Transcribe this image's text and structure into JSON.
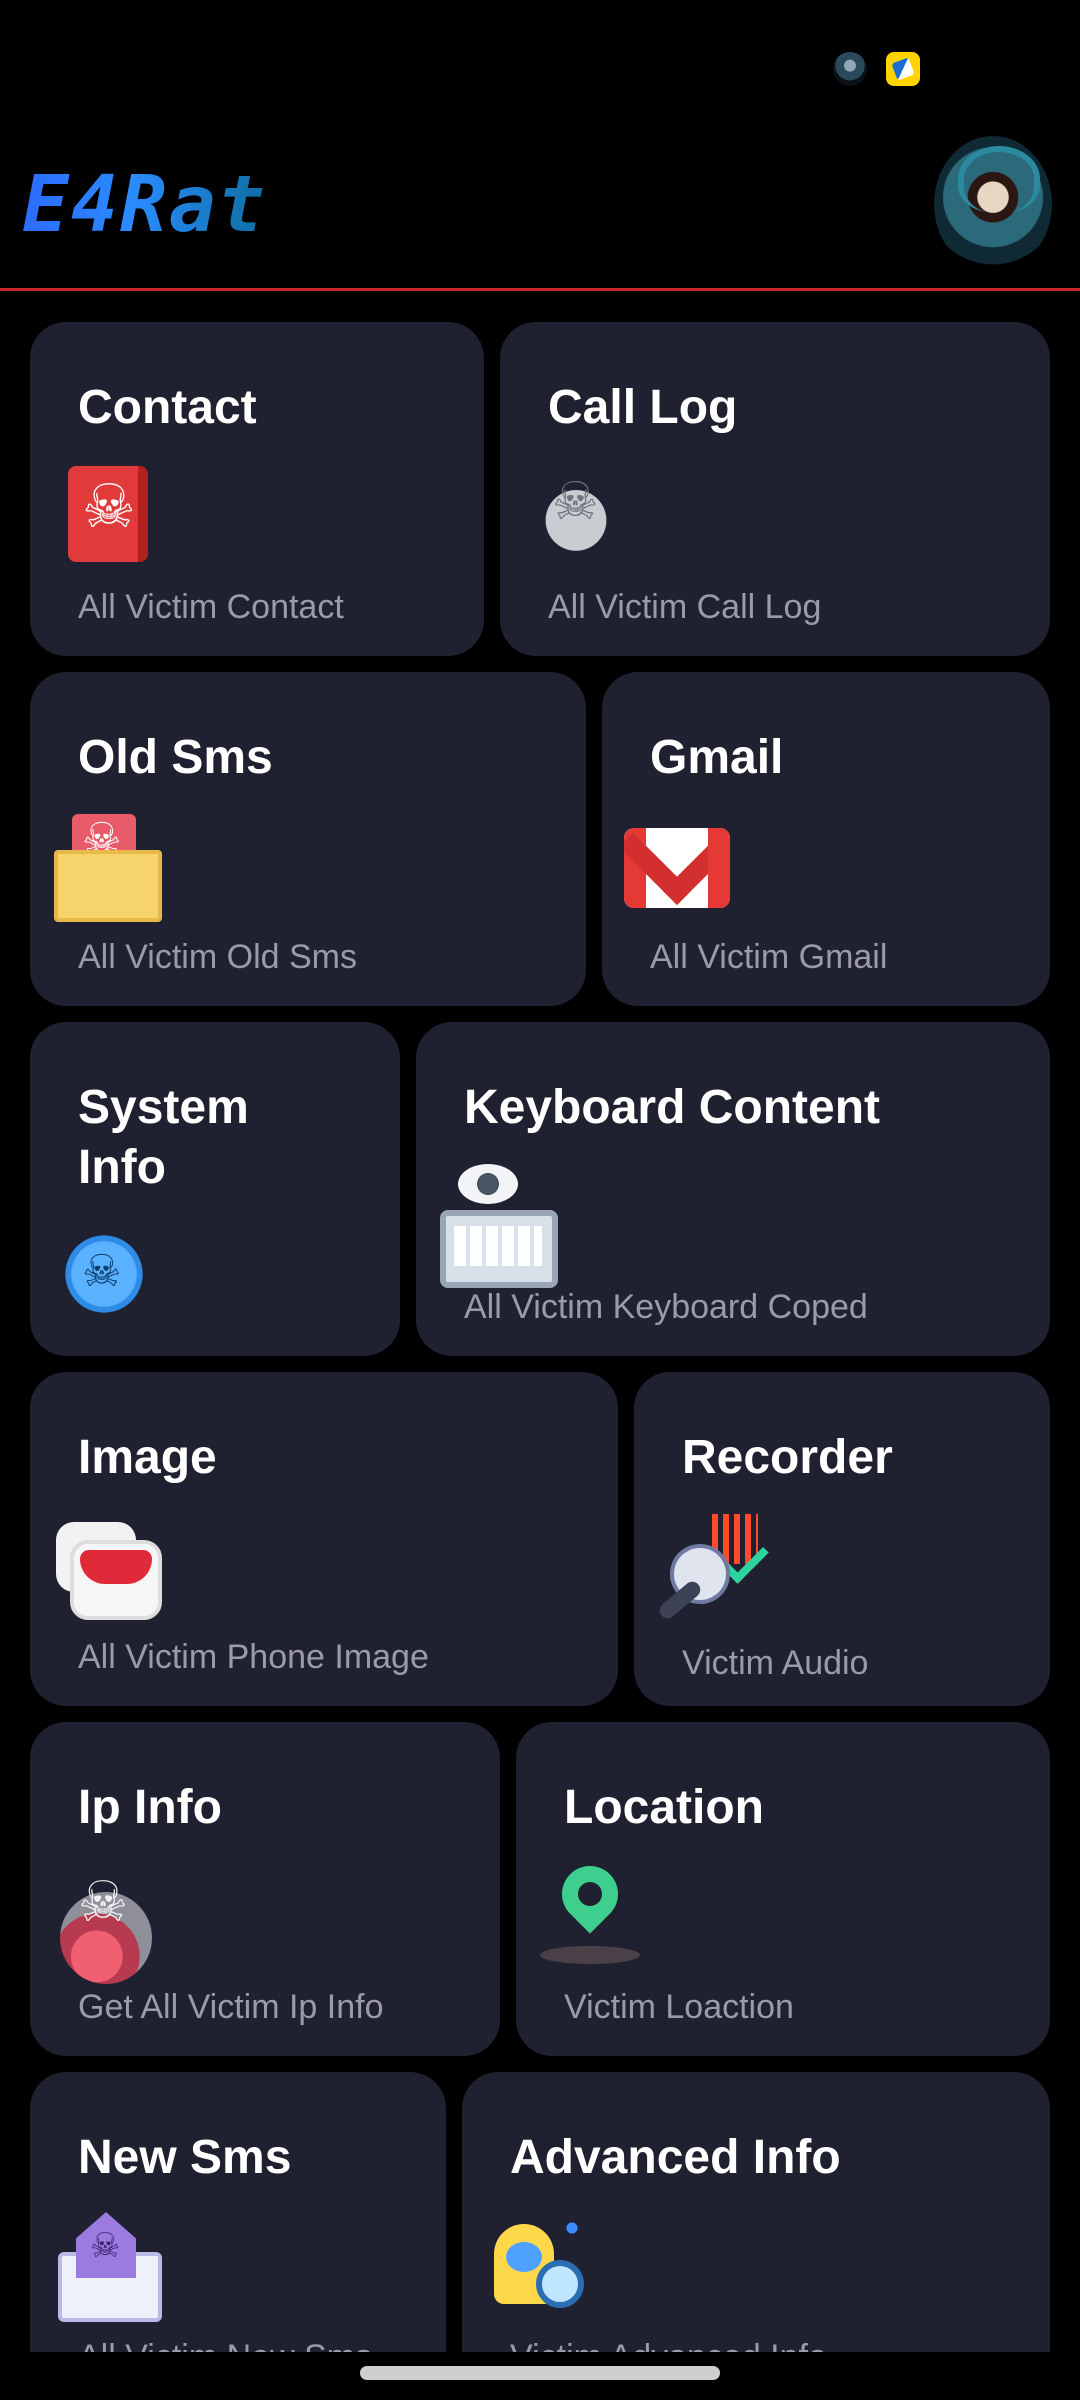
{
  "app": {
    "title": "E4Rat"
  },
  "status_bar": {
    "icons": [
      "hacker-avatar-icon",
      "app-notification-icon"
    ]
  },
  "header": {
    "logo_text": "E4Rat",
    "avatar_icon": "skull-hood-avatar-icon"
  },
  "colors": {
    "background": "#000000",
    "card": "#1f2030",
    "divider": "#c62828",
    "subtitle": "#9a9aaa",
    "logo_start": "#2d6bff",
    "logo_end": "#0d6fa0"
  },
  "cards": [
    {
      "id": "contact",
      "title": "Contact",
      "subtitle": "All Victim Contact",
      "icon": "skull-book-icon"
    },
    {
      "id": "call-log",
      "title": "Call Log",
      "subtitle": "All Victim Call Log",
      "icon": "skull-cloud-icon"
    },
    {
      "id": "old-sms",
      "title": "Old Sms",
      "subtitle": "All Victim Old Sms",
      "icon": "skull-mail-icon"
    },
    {
      "id": "gmail",
      "title": "Gmail",
      "subtitle": "All Victim Gmail",
      "icon": "gmail-icon"
    },
    {
      "id": "system-info",
      "title": "System Info",
      "subtitle": "",
      "icon": "virus-skull-icon"
    },
    {
      "id": "keyboard-content",
      "title": "Keyboard Content",
      "subtitle": "All Victim Keyboard Coped",
      "icon": "keyboard-eye-icon"
    },
    {
      "id": "image",
      "title": "Image",
      "subtitle": "All Victim Phone Image",
      "icon": "image-stack-icon"
    },
    {
      "id": "recorder",
      "title": "Recorder",
      "subtitle": "Victim Audio",
      "icon": "microphone-icon"
    },
    {
      "id": "ip-info",
      "title": "Ip Info",
      "subtitle": "Get All Victim Ip Info",
      "icon": "skull-globe-icon"
    },
    {
      "id": "location",
      "title": "Location",
      "subtitle": "Victim Loaction",
      "icon": "location-pin-icon"
    },
    {
      "id": "new-sms",
      "title": "New Sms",
      "subtitle": "All Victim New Sms",
      "icon": "purple-skull-mail-icon"
    },
    {
      "id": "advanced-info",
      "title": "Advanced Info",
      "subtitle": "Victim Advanced Info",
      "icon": "hacker-search-icon"
    }
  ]
}
